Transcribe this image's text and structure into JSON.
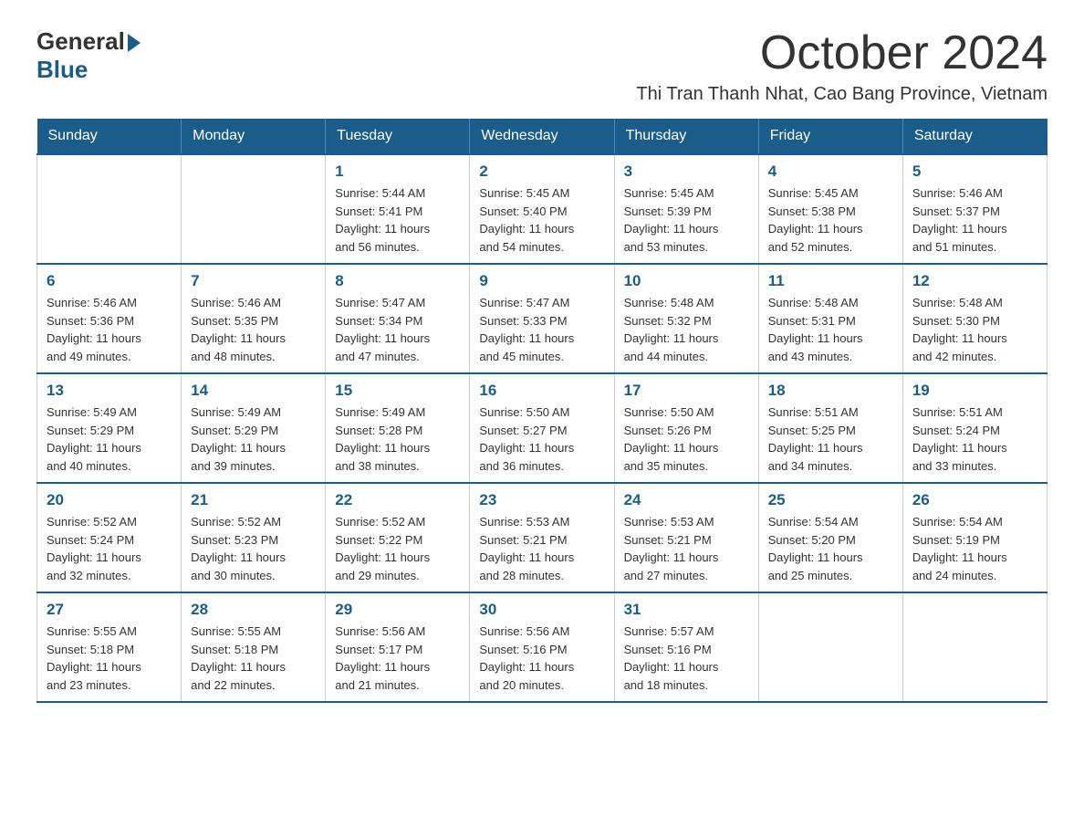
{
  "logo": {
    "general": "General",
    "blue": "Blue"
  },
  "title": "October 2024",
  "location": "Thi Tran Thanh Nhat, Cao Bang Province, Vietnam",
  "days_of_week": [
    "Sunday",
    "Monday",
    "Tuesday",
    "Wednesday",
    "Thursday",
    "Friday",
    "Saturday"
  ],
  "weeks": [
    [
      {
        "day": "",
        "info": ""
      },
      {
        "day": "",
        "info": ""
      },
      {
        "day": "1",
        "info": "Sunrise: 5:44 AM\nSunset: 5:41 PM\nDaylight: 11 hours\nand 56 minutes."
      },
      {
        "day": "2",
        "info": "Sunrise: 5:45 AM\nSunset: 5:40 PM\nDaylight: 11 hours\nand 54 minutes."
      },
      {
        "day": "3",
        "info": "Sunrise: 5:45 AM\nSunset: 5:39 PM\nDaylight: 11 hours\nand 53 minutes."
      },
      {
        "day": "4",
        "info": "Sunrise: 5:45 AM\nSunset: 5:38 PM\nDaylight: 11 hours\nand 52 minutes."
      },
      {
        "day": "5",
        "info": "Sunrise: 5:46 AM\nSunset: 5:37 PM\nDaylight: 11 hours\nand 51 minutes."
      }
    ],
    [
      {
        "day": "6",
        "info": "Sunrise: 5:46 AM\nSunset: 5:36 PM\nDaylight: 11 hours\nand 49 minutes."
      },
      {
        "day": "7",
        "info": "Sunrise: 5:46 AM\nSunset: 5:35 PM\nDaylight: 11 hours\nand 48 minutes."
      },
      {
        "day": "8",
        "info": "Sunrise: 5:47 AM\nSunset: 5:34 PM\nDaylight: 11 hours\nand 47 minutes."
      },
      {
        "day": "9",
        "info": "Sunrise: 5:47 AM\nSunset: 5:33 PM\nDaylight: 11 hours\nand 45 minutes."
      },
      {
        "day": "10",
        "info": "Sunrise: 5:48 AM\nSunset: 5:32 PM\nDaylight: 11 hours\nand 44 minutes."
      },
      {
        "day": "11",
        "info": "Sunrise: 5:48 AM\nSunset: 5:31 PM\nDaylight: 11 hours\nand 43 minutes."
      },
      {
        "day": "12",
        "info": "Sunrise: 5:48 AM\nSunset: 5:30 PM\nDaylight: 11 hours\nand 42 minutes."
      }
    ],
    [
      {
        "day": "13",
        "info": "Sunrise: 5:49 AM\nSunset: 5:29 PM\nDaylight: 11 hours\nand 40 minutes."
      },
      {
        "day": "14",
        "info": "Sunrise: 5:49 AM\nSunset: 5:29 PM\nDaylight: 11 hours\nand 39 minutes."
      },
      {
        "day": "15",
        "info": "Sunrise: 5:49 AM\nSunset: 5:28 PM\nDaylight: 11 hours\nand 38 minutes."
      },
      {
        "day": "16",
        "info": "Sunrise: 5:50 AM\nSunset: 5:27 PM\nDaylight: 11 hours\nand 36 minutes."
      },
      {
        "day": "17",
        "info": "Sunrise: 5:50 AM\nSunset: 5:26 PM\nDaylight: 11 hours\nand 35 minutes."
      },
      {
        "day": "18",
        "info": "Sunrise: 5:51 AM\nSunset: 5:25 PM\nDaylight: 11 hours\nand 34 minutes."
      },
      {
        "day": "19",
        "info": "Sunrise: 5:51 AM\nSunset: 5:24 PM\nDaylight: 11 hours\nand 33 minutes."
      }
    ],
    [
      {
        "day": "20",
        "info": "Sunrise: 5:52 AM\nSunset: 5:24 PM\nDaylight: 11 hours\nand 32 minutes."
      },
      {
        "day": "21",
        "info": "Sunrise: 5:52 AM\nSunset: 5:23 PM\nDaylight: 11 hours\nand 30 minutes."
      },
      {
        "day": "22",
        "info": "Sunrise: 5:52 AM\nSunset: 5:22 PM\nDaylight: 11 hours\nand 29 minutes."
      },
      {
        "day": "23",
        "info": "Sunrise: 5:53 AM\nSunset: 5:21 PM\nDaylight: 11 hours\nand 28 minutes."
      },
      {
        "day": "24",
        "info": "Sunrise: 5:53 AM\nSunset: 5:21 PM\nDaylight: 11 hours\nand 27 minutes."
      },
      {
        "day": "25",
        "info": "Sunrise: 5:54 AM\nSunset: 5:20 PM\nDaylight: 11 hours\nand 25 minutes."
      },
      {
        "day": "26",
        "info": "Sunrise: 5:54 AM\nSunset: 5:19 PM\nDaylight: 11 hours\nand 24 minutes."
      }
    ],
    [
      {
        "day": "27",
        "info": "Sunrise: 5:55 AM\nSunset: 5:18 PM\nDaylight: 11 hours\nand 23 minutes."
      },
      {
        "day": "28",
        "info": "Sunrise: 5:55 AM\nSunset: 5:18 PM\nDaylight: 11 hours\nand 22 minutes."
      },
      {
        "day": "29",
        "info": "Sunrise: 5:56 AM\nSunset: 5:17 PM\nDaylight: 11 hours\nand 21 minutes."
      },
      {
        "day": "30",
        "info": "Sunrise: 5:56 AM\nSunset: 5:16 PM\nDaylight: 11 hours\nand 20 minutes."
      },
      {
        "day": "31",
        "info": "Sunrise: 5:57 AM\nSunset: 5:16 PM\nDaylight: 11 hours\nand 18 minutes."
      },
      {
        "day": "",
        "info": ""
      },
      {
        "day": "",
        "info": ""
      }
    ]
  ]
}
